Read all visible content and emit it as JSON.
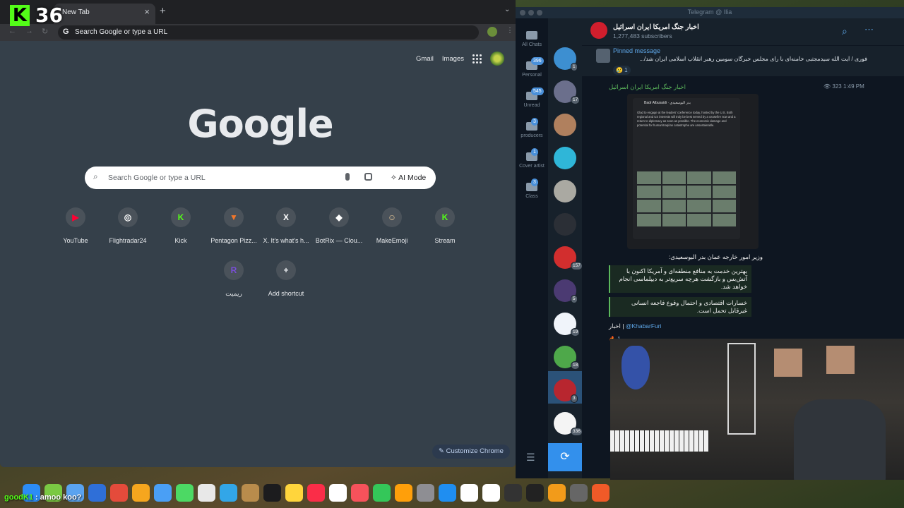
{
  "overlay": {
    "kick_logo": "K",
    "viewer_count": "36",
    "chat_user": "goodK1",
    "chat_message": ": amoo koo?"
  },
  "chrome": {
    "tab_title": "New Tab",
    "omnibox_text": "Search Google or type a URL",
    "ntp": {
      "links": [
        "Gmail",
        "Images"
      ],
      "logo": "Google",
      "search_placeholder": "Search Google or type a URL",
      "ai_mode_label": "AI Mode",
      "shortcuts": [
        {
          "label": "YouTube",
          "icon": "youtube-icon",
          "glyph": "▶",
          "color": "#ff0033"
        },
        {
          "label": "Flightradar24",
          "icon": "flightradar-icon",
          "glyph": "◎",
          "color": "#ffffff"
        },
        {
          "label": "Kick",
          "icon": "kick-icon",
          "glyph": "K",
          "color": "#53fc18"
        },
        {
          "label": "Pentagon Pizz...",
          "icon": "pizza-icon",
          "glyph": "▼",
          "color": "#f2762a"
        },
        {
          "label": "X. It's what's h...",
          "icon": "x-icon",
          "glyph": "X",
          "color": "#ffffff"
        },
        {
          "label": "BotRix — Clou...",
          "icon": "botrix-icon",
          "glyph": "◆",
          "color": "#ffffff"
        },
        {
          "label": "MakeEmoji",
          "icon": "makeemoji-icon",
          "glyph": "☺",
          "color": "#e8c89a"
        },
        {
          "label": "Stream",
          "icon": "kick-stream-icon",
          "glyph": "K",
          "color": "#53fc18"
        },
        {
          "label": "ریمیت",
          "icon": "remit-icon",
          "glyph": "R",
          "color": "#7a4fd9"
        },
        {
          "label": "Add shortcut",
          "icon": "plus-icon",
          "glyph": "+",
          "color": "#e8eaed"
        }
      ],
      "customize_label": "Customize Chrome"
    }
  },
  "telegram": {
    "window_title": "Telegram @ Ilia",
    "folders": [
      {
        "label": "All Chats",
        "badge": ""
      },
      {
        "label": "Personal",
        "badge": "396"
      },
      {
        "label": "Unread",
        "badge": "545"
      },
      {
        "label": "producers",
        "badge": "3"
      },
      {
        "label": "Cover artist",
        "badge": "1"
      },
      {
        "label": "Class",
        "badge": "3"
      }
    ],
    "chats": [
      {
        "badge": "1",
        "color": "#3d8fd1"
      },
      {
        "badge": "17",
        "color": "#6b6f8c"
      },
      {
        "badge": "",
        "color": "#b0805e"
      },
      {
        "badge": "",
        "color": "#2fb6d8"
      },
      {
        "badge": "",
        "color": "#aaa9a2"
      },
      {
        "badge": "",
        "color": "#2b2f36"
      },
      {
        "badge": "157",
        "color": "#d22e2e"
      },
      {
        "badge": "5",
        "color": "#4b3a72"
      },
      {
        "badge": "19",
        "color": "#f0f4fa"
      },
      {
        "badge": "18",
        "color": "#4ea84a"
      },
      {
        "badge": "3",
        "color": "#b8262f"
      },
      {
        "badge": "336",
        "color": "#f4f4f4"
      }
    ],
    "channel": {
      "name": "اخبار جنگ امریکا ایران اسرائیل",
      "subscribers": "1,277,483 subscribers",
      "pinned_label": "Pinned message",
      "pinned_text": "فوری / آیت الله سیدمجتبی خامنه‌ای با رای مجلس خبرگان سومین رهبر انقلاب اسلامی ایران شد/...",
      "pinned_reaction": "😢 1"
    },
    "message": {
      "sender": "اخبار جنگ امریکا ایران اسرائیل",
      "views_time": "323 1:49 PM",
      "tweet_author": "Badr Albusaidi · بدر البوسعيدي",
      "tweet_text": "Glad to engage at the leaders' conference today, hosted by the U.S. Both regional and US interests will truly be best served by a ceasefire now and a return to diplomacy as soon as possible. The economic damage and potential for human/Iraqi/an catastrophe are unsustainable.",
      "caption": "وزیر امور خارجه عمان بدر البوسعیدی:",
      "quotes": [
        "بهترین خدمت به منافع منطقه‌ای و آمریکا اکنون با آتش‌بس و بازگشت هرچه سریع‌تر به دیپلماسی انجام خواهد شد.",
        "خسارات اقتصادی و احتمال وقوع فاجعه انسانی غیرقابل تحمل است."
      ],
      "footer_prefix": "اخبار | ",
      "footer_link": "@KhabarFuri",
      "reaction": "1"
    }
  },
  "dock": [
    "#2c8cf6",
    "#7ac943",
    "#5aa3f0",
    "#2f6fd8",
    "#e44b3b",
    "#f6a61e",
    "#4a9ff5",
    "#4cd964",
    "#e8e8e8",
    "#32a6e8",
    "#b98c4c",
    "#1c1c1e",
    "#ffd53c",
    "#fa2d48",
    "#ffffff",
    "#f7525b",
    "#34c759",
    "#ff9f0a",
    "#8e8e93",
    "#1f8ef1",
    "#ffffff",
    "#ffffff",
    "#333333",
    "#222222",
    "#f29b1a",
    "#666666",
    "#f05a28"
  ]
}
